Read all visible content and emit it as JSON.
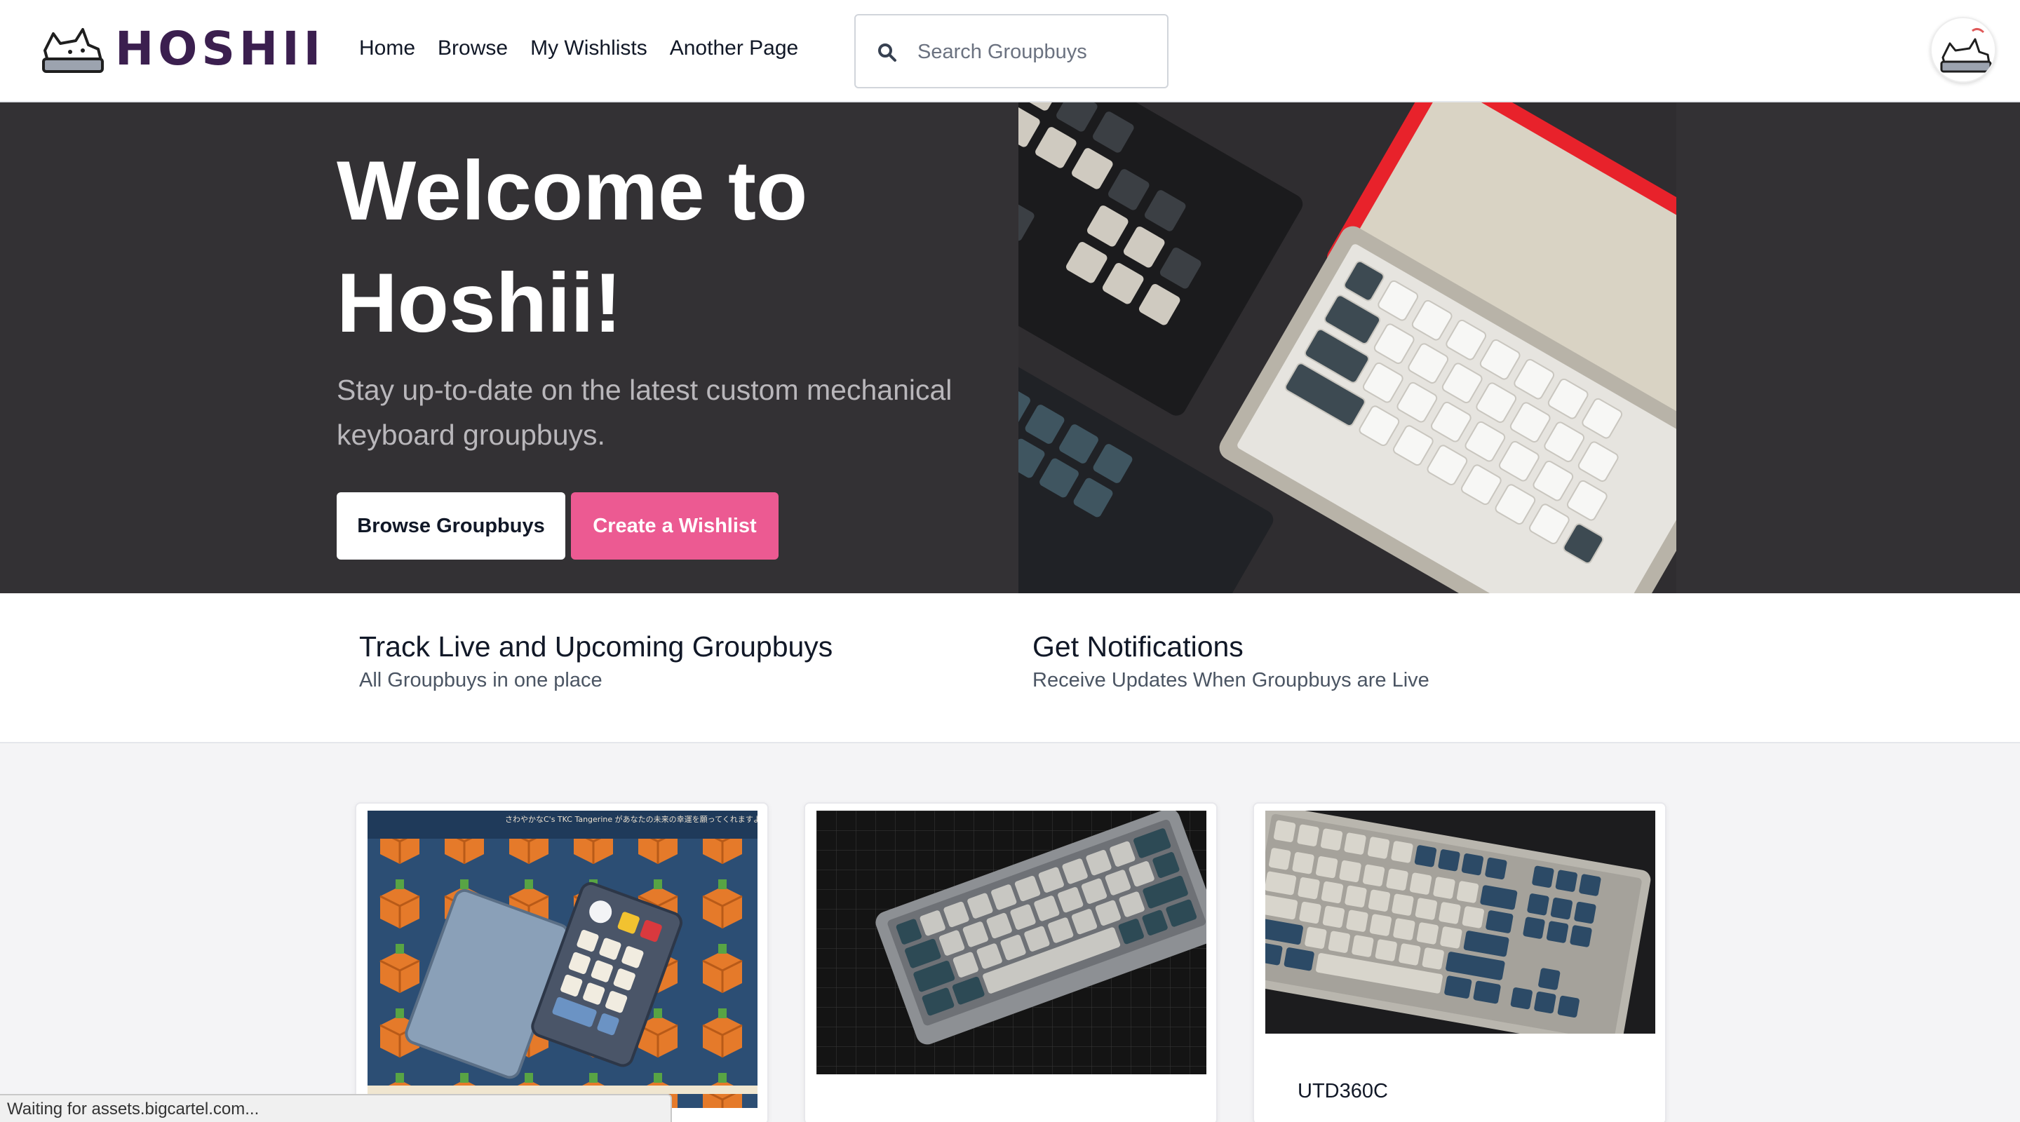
{
  "brand": {
    "logo_text": "HOSHII"
  },
  "nav": {
    "items": [
      {
        "label": "Home"
      },
      {
        "label": "Browse"
      },
      {
        "label": "My Wishlists"
      },
      {
        "label": "Another Page"
      }
    ]
  },
  "search": {
    "placeholder": "Search Groupbuys"
  },
  "hero": {
    "title": "Welcome to Hoshii!",
    "subtitle": "Stay up-to-date on the latest custom mechanical keyboard groupbuys.",
    "primary_button": "Browse Groupbuys",
    "secondary_button": "Create a Wishlist"
  },
  "features": [
    {
      "title": "Track Live and Upcoming Groupbuys",
      "description": "All Groupbuys in one place"
    },
    {
      "title": "Get Notifications",
      "description": "Receive Updates When Groupbuys are Live"
    }
  ],
  "cards": [
    {
      "title": "",
      "image_alt": "Tangerine themed keyboard and numpad on deskmat",
      "image_text": "さわやかなC's TKC Tangerine があなたの未来の幸運を願ってくれますように。"
    },
    {
      "title": "",
      "image_alt": "Grey 65% keyboard with dark keycaps on grid mat"
    },
    {
      "title": "UTD360C",
      "image_alt": "UTD360C tenkeyless keyboard with blue and grey keycaps"
    }
  ],
  "status_bar": {
    "text": "Waiting for assets.bigcartel.com..."
  },
  "colors": {
    "brand": "#3b1f4f",
    "accent_pink": "#ec5a92",
    "hero_bg": "#333134"
  }
}
